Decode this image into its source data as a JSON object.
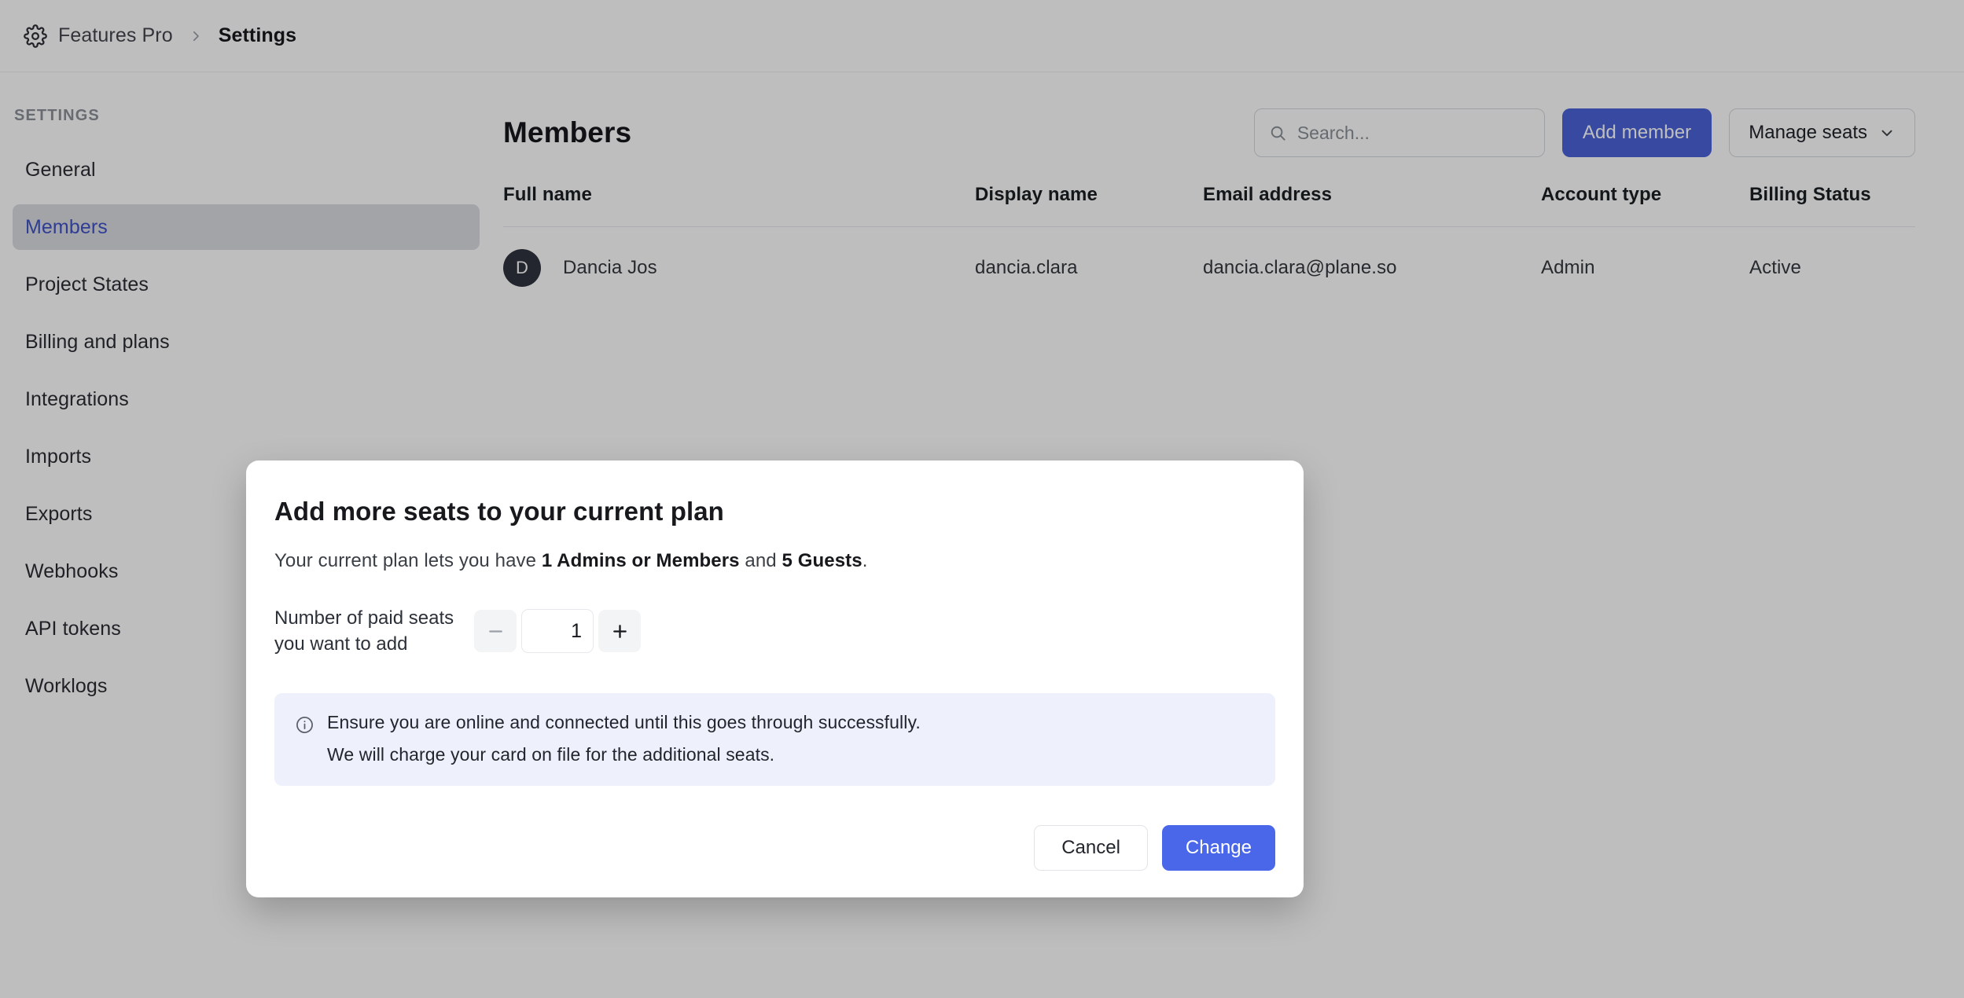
{
  "breadcrumb": {
    "gear_icon": "gear-icon",
    "workspace": "Features Pro",
    "separator_icon": "chevron-right-icon",
    "current": "Settings"
  },
  "sidebar": {
    "title": "SETTINGS",
    "items": [
      {
        "label": "General",
        "active": false
      },
      {
        "label": "Members",
        "active": true
      },
      {
        "label": "Project States",
        "active": false
      },
      {
        "label": "Billing and plans",
        "active": false
      },
      {
        "label": "Integrations",
        "active": false
      },
      {
        "label": "Imports",
        "active": false
      },
      {
        "label": "Exports",
        "active": false
      },
      {
        "label": "Webhooks",
        "active": false
      },
      {
        "label": "API tokens",
        "active": false
      },
      {
        "label": "Worklogs",
        "active": false
      }
    ]
  },
  "main": {
    "title": "Members",
    "search": {
      "icon": "search-icon",
      "placeholder": "Search...",
      "value": ""
    },
    "add_member_label": "Add member",
    "manage_seats_label": "Manage seats",
    "manage_seats_icon": "chevron-down-icon",
    "table": {
      "headers": [
        "Full name",
        "Display name",
        "Email address",
        "Account type",
        "Billing Status"
      ],
      "rows": [
        {
          "avatar_initial": "D",
          "full_name": "Dancia Jos",
          "display_name": "dancia.clara",
          "email": "dancia.clara@plane.so",
          "account_type": "Admin",
          "billing_status": "Active"
        }
      ]
    }
  },
  "modal": {
    "title": "Add more seats to your current plan",
    "subtitle": {
      "lead": "Your current plan lets you have ",
      "strong_1": "1 Admins or Members",
      "mid": " and ",
      "strong_2": "5 Guests",
      "tail": "."
    },
    "seat_label": "Number of paid seats you want to add",
    "stepper": {
      "decrement_icon": "minus-icon",
      "increment_icon": "plus-icon",
      "value": "1"
    },
    "notice": {
      "icon": "info-circle-icon",
      "line_1": "Ensure you are online and connected until this goes through successfully.",
      "line_2": "We will charge your card on file for the additional seats."
    },
    "cancel_label": "Cancel",
    "confirm_label": "Change"
  },
  "colors": {
    "accent_blue": "#4a67ea",
    "primary_button": "#4c62d9",
    "sidebar_active_text": "#3f53c8",
    "sidebar_active_bg": "#dbdde2",
    "notice_bg": "#eef0fb",
    "avatar_bg": "#2f3440"
  }
}
